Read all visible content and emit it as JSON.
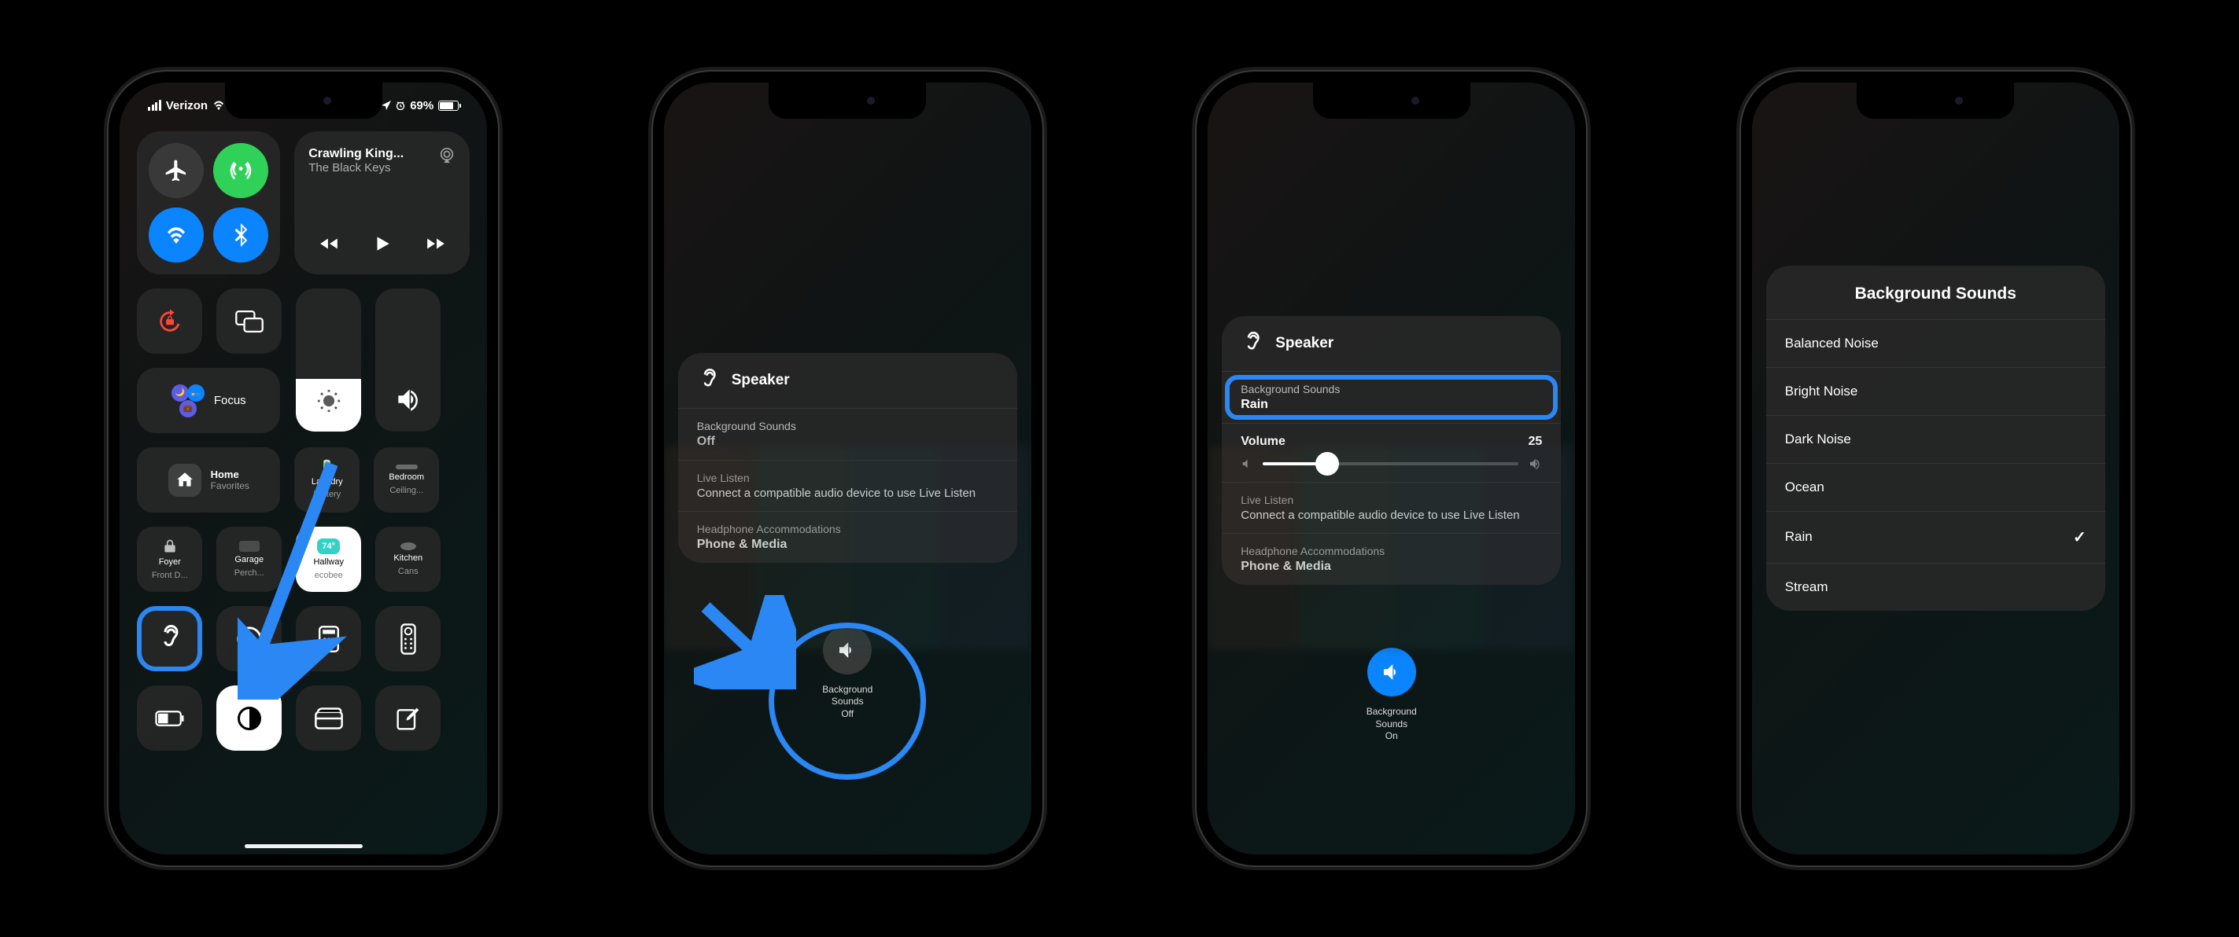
{
  "phone1": {
    "status": {
      "carrier": "Verizon",
      "battery_pct": "69%",
      "location_icon": "location",
      "alarm_icon": "alarm"
    },
    "connectivity": {
      "airplane_on": false,
      "antenna_on": true,
      "wifi_on": true,
      "bluetooth_on": true
    },
    "now_playing": {
      "title": "Crawling King...",
      "artist": "The Black Keys"
    },
    "focus": {
      "label": "Focus"
    },
    "brightness_pct": 37,
    "homekit": {
      "header": {
        "title": "Home",
        "sub": "Favorites"
      },
      "laundry": {
        "title": "Laundry",
        "sub": "Battery"
      },
      "bedroom": {
        "title": "Bedroom",
        "sub": "Ceiling..."
      },
      "foyer": {
        "title": "Foyer",
        "sub": "Front D..."
      },
      "garage": {
        "title": "Garage",
        "sub": "Perch..."
      },
      "hallway": {
        "title": "Hallway",
        "sub": "ecobee",
        "badge": "74°"
      },
      "kitchen": {
        "title": "Kitchen",
        "sub": "Cans"
      }
    }
  },
  "phone2": {
    "header": "Speaker",
    "bg_sounds_label": "Background Sounds",
    "bg_sounds_value": "Off",
    "live_listen_label": "Live Listen",
    "live_listen_value": "Connect a compatible audio device to use Live Listen",
    "hp_accom_label": "Headphone Accommodations",
    "hp_accom_value": "Phone & Media",
    "bg_btn_title": "Background\nSounds",
    "bg_btn_state": "Off"
  },
  "phone3": {
    "header": "Speaker",
    "bg_sounds_label": "Background Sounds",
    "bg_sounds_value": "Rain",
    "volume_label": "Volume",
    "volume_value": "25",
    "live_listen_label": "Live Listen",
    "live_listen_value": "Connect a compatible audio device to use Live Listen",
    "hp_accom_label": "Headphone Accommodations",
    "hp_accom_value": "Phone & Media",
    "bg_btn_title": "Background\nSounds",
    "bg_btn_state": "On"
  },
  "phone4": {
    "title": "Background Sounds",
    "options": [
      "Balanced Noise",
      "Bright Noise",
      "Dark Noise",
      "Ocean",
      "Rain",
      "Stream"
    ],
    "selected": "Rain"
  }
}
